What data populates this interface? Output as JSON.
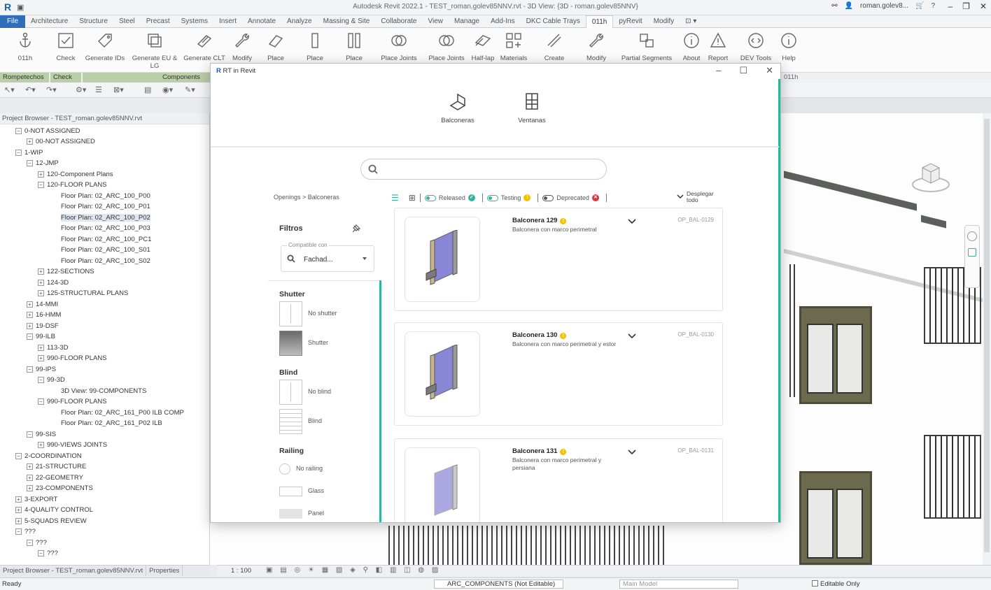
{
  "app": {
    "title": "Autodesk Revit 2022.1 - TEST_roman.golev85NNV.rvt - 3D View: {3D - roman.golev85NNV}",
    "user": "roman.golev8...",
    "status_ready": "Ready"
  },
  "ribbon_tabs": [
    {
      "label": "File"
    },
    {
      "label": "Architecture"
    },
    {
      "label": "Structure"
    },
    {
      "label": "Steel"
    },
    {
      "label": "Precast"
    },
    {
      "label": "Systems"
    },
    {
      "label": "Insert"
    },
    {
      "label": "Annotate"
    },
    {
      "label": "Analyze"
    },
    {
      "label": "Massing & Site"
    },
    {
      "label": "Collaborate"
    },
    {
      "label": "View"
    },
    {
      "label": "Manage"
    },
    {
      "label": "Add-Ins"
    },
    {
      "label": "DKC Cable Trays"
    },
    {
      "label": "011h"
    },
    {
      "label": "pyRevit"
    },
    {
      "label": "Modify"
    }
  ],
  "ribbon_buttons": [
    {
      "label": "011h"
    },
    {
      "label": "Check"
    },
    {
      "label": "Generate IDs"
    },
    {
      "label": "Generate EU & LG"
    },
    {
      "label": "Generate CLT"
    },
    {
      "label": "Modify"
    },
    {
      "label": "Place"
    },
    {
      "label": "Place"
    },
    {
      "label": "Place"
    },
    {
      "label": "Place Joints"
    },
    {
      "label": "Place Joints"
    },
    {
      "label": "Half-lap"
    },
    {
      "label": "Materials"
    },
    {
      "label": "Create"
    },
    {
      "label": "Modify"
    },
    {
      "label": "Partial Segments"
    },
    {
      "label": "About"
    },
    {
      "label": "Report"
    },
    {
      "label": "DEV Tools"
    },
    {
      "label": "Help"
    }
  ],
  "ribbon_groups": {
    "rompetechos": "Rompetechos",
    "check": "Check",
    "components": "Components",
    "tab_name": "011h"
  },
  "project_browser": {
    "header": "Project Browser - TEST_roman.golev85NNV.rvt",
    "tab_browser": "Project Browser - TEST_roman.golev85NNV.rvt",
    "tab_properties": "Properties",
    "items": [
      {
        "label": "0-NOT ASSIGNED"
      },
      {
        "label": "00-NOT ASSIGNED"
      },
      {
        "label": "1-WIP"
      },
      {
        "label": "12-JMP"
      },
      {
        "label": "120-Component Plans"
      },
      {
        "label": "120-FLOOR PLANS"
      },
      {
        "label": "Floor Plan: 02_ARC_100_P00"
      },
      {
        "label": "Floor Plan: 02_ARC_100_P01"
      },
      {
        "label": "Floor Plan: 02_ARC_100_P02"
      },
      {
        "label": "Floor Plan: 02_ARC_100_P03"
      },
      {
        "label": "Floor Plan: 02_ARC_100_PC1"
      },
      {
        "label": "Floor Plan: 02_ARC_100_S01"
      },
      {
        "label": "Floor Plan: 02_ARC_100_S02"
      },
      {
        "label": "122-SECTIONS"
      },
      {
        "label": "124-3D"
      },
      {
        "label": "125-STRUCTURAL PLANS"
      },
      {
        "label": "14-MMI"
      },
      {
        "label": "16-HMM"
      },
      {
        "label": "19-DSF"
      },
      {
        "label": "99-ILB"
      },
      {
        "label": "113-3D"
      },
      {
        "label": "990-FLOOR PLANS"
      },
      {
        "label": "99-IPS"
      },
      {
        "label": "99-3D"
      },
      {
        "label": "3D View: 99-COMPONENTS"
      },
      {
        "label": "990-FLOOR PLANS"
      },
      {
        "label": "Floor Plan: 02_ARC_161_P00 ILB COMP"
      },
      {
        "label": "Floor Plan: 02_ARC_161_P02 ILB"
      },
      {
        "label": "99-SIS"
      },
      {
        "label": "990-VIEWS JOINTS"
      },
      {
        "label": "2-COORDINATION"
      },
      {
        "label": "21-STRUCTURE"
      },
      {
        "label": "22-GEOMETRY"
      },
      {
        "label": "23-COMPONENTS"
      },
      {
        "label": "3-EXPORT"
      },
      {
        "label": "4-QUALITY CONTROL"
      },
      {
        "label": "5-SQUADS REVIEW"
      },
      {
        "label": "???"
      },
      {
        "label": "???"
      },
      {
        "label": "???"
      }
    ]
  },
  "view_control": {
    "scale": "1 : 100"
  },
  "statusbar": {
    "workset": "ARC_COMPONENTS (Not Editable)",
    "model": "Main Model",
    "editable_only": "Editable Only"
  },
  "dialog": {
    "title": "RT in Revit",
    "categories": [
      {
        "label": "Balconeras"
      },
      {
        "label": "Ventanas"
      }
    ],
    "search_placeholder": "",
    "breadcrumb": "Openings > Balconeras",
    "toolbar": {
      "released": "Released",
      "testing": "Testing",
      "deprecated": "Deprecated",
      "expand_all": "Desplegar todo",
      "colors": {
        "released": "#33b39a",
        "testing": "#f2c200",
        "deprecated": "#d9363e"
      }
    },
    "filters": {
      "title": "Filtros",
      "compatible_label": "Compatible con",
      "compatible_value": "Fachad...",
      "groups": [
        {
          "title": "Shutter",
          "options": [
            {
              "label": "No shutter"
            },
            {
              "label": "Shutter"
            }
          ]
        },
        {
          "title": "Blind",
          "options": [
            {
              "label": "No blind"
            },
            {
              "label": "Blind"
            }
          ]
        },
        {
          "title": "Railing",
          "options": [
            {
              "label": "No railing"
            },
            {
              "label": "Glass"
            },
            {
              "label": "Panel"
            }
          ]
        }
      ]
    },
    "results": [
      {
        "name": "Balconera 129",
        "desc": "Balconera con marco perimetral",
        "code": "OP_BAL-0129"
      },
      {
        "name": "Balconera 130",
        "desc": "Balconera con marco perimetral y estor",
        "code": "OP_BAL-0130"
      },
      {
        "name": "Balconera 131",
        "desc": "Balconera con marco perimetral y persiana",
        "code": "OP_BAL-0131"
      }
    ]
  }
}
